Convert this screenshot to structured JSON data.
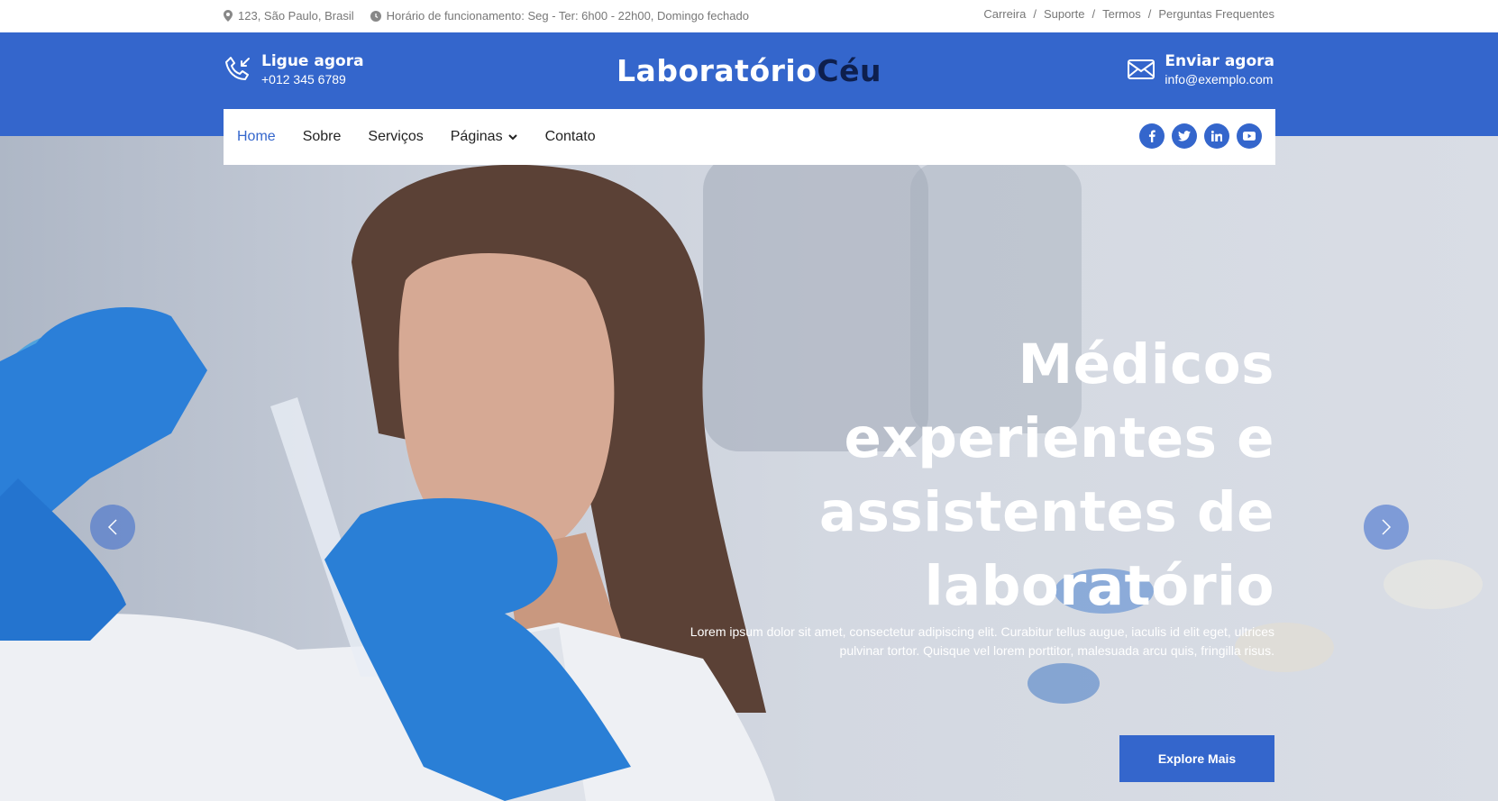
{
  "topbar": {
    "address": "123, São Paulo, Brasil",
    "hours": "Horário de funcionamento: Seg - Ter: 6h00 - 22h00, Domingo fechado",
    "links": [
      "Carreira",
      "Suporte",
      "Termos",
      "Perguntas Frequentes"
    ],
    "separator": "/"
  },
  "header": {
    "call_label": "Ligue agora",
    "call_value": "+012 345 6789",
    "logo_part1": "Laboratório",
    "logo_part2": "Céu",
    "mail_label": "Enviar agora",
    "mail_value": "info@exemplo.com"
  },
  "nav": {
    "items": [
      "Home",
      "Sobre",
      "Serviços",
      "Páginas",
      "Contato"
    ],
    "active": "Home",
    "social_icons": [
      "facebook-icon",
      "twitter-icon",
      "linkedin-icon",
      "youtube-icon"
    ]
  },
  "hero": {
    "title_lines": [
      "Médicos",
      "experientes e",
      "assistentes de",
      "laboratório"
    ],
    "text_line1": "Lorem ipsum dolor sit amet, consectetur adipiscing elit. Curabitur tellus augue, iaculis id elit eget, ultrices",
    "text_line2": "pulvinar tortor. Quisque vel lorem porttitor, malesuada arcu quis, fringilla risus.",
    "button": "Explore Mais"
  },
  "colors": {
    "accent": "#3466cc",
    "dark": "#0e1f4d"
  }
}
